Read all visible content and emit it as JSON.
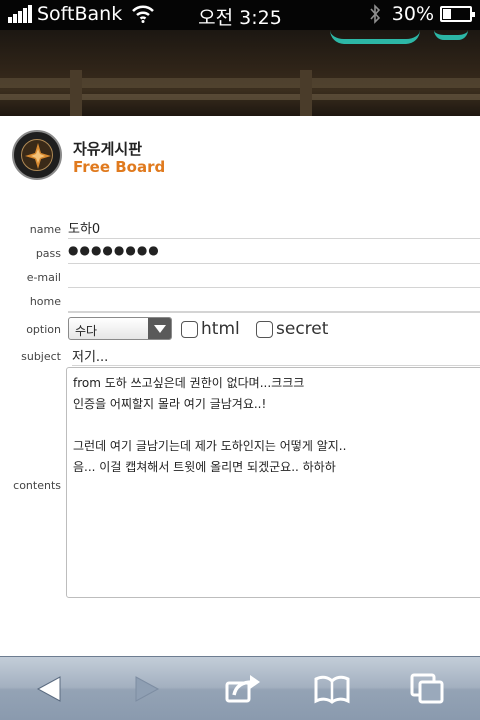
{
  "status_bar": {
    "carrier": "SoftBank",
    "time": "오전 3:25",
    "battery_text": "30%",
    "battery_level": 0.3
  },
  "header": {
    "board_title": "자유게시판",
    "board_subtitle": "Free Board"
  },
  "form": {
    "name_label": "name",
    "name_value": "도하0",
    "pass_label": "pass",
    "pass_value": "●●●●●●●●",
    "email_label": "e-mail",
    "email_value": "",
    "home_label": "home",
    "home_value": "",
    "option_label": "option",
    "option_selected": "수다",
    "html_label": "html",
    "secret_label": "secret",
    "subject_label": "subject",
    "subject_value": "저기...",
    "contents_label": "contents",
    "contents_lines": [
      "from 도하 쓰고싶은데 권한이 없다며...크크크",
      "인증을 어찌할지 몰라 여기 글남겨요..!",
      "",
      "그런데 여기 글남기는데 제가 도하인지는 어떻게 알지..",
      "음... 이걸 캡쳐해서 트윗에 올리면 되겠군요.. 하하하"
    ]
  },
  "toolbar": {
    "icons": [
      "back-arrow-icon",
      "forward-arrow-icon",
      "share-icon",
      "bookmarks-icon",
      "tabs-icon"
    ]
  }
}
